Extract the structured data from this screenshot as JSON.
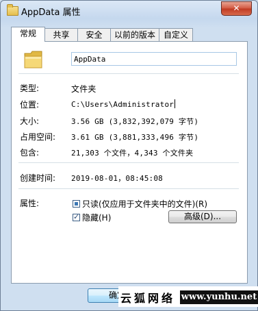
{
  "window": {
    "title": "AppData 属性",
    "close_label": "✕"
  },
  "tabs": [
    {
      "label": "常规",
      "active": true
    },
    {
      "label": "共享",
      "active": false
    },
    {
      "label": "安全",
      "active": false
    },
    {
      "label": "以前的版本",
      "active": false
    },
    {
      "label": "自定义",
      "active": false
    }
  ],
  "general": {
    "folder_name": "AppData",
    "icon": "folder-icon",
    "rows": [
      {
        "label": "类型:",
        "value": "文件夹"
      },
      {
        "label": "位置:",
        "value": "C:\\Users\\Administrator"
      },
      {
        "label": "大小:",
        "value": "3.56 GB (3,832,392,079 字节)"
      },
      {
        "label": "占用空间:",
        "value": "3.61 GB (3,881,333,496 字节)"
      },
      {
        "label": "包含:",
        "value": "21,303 个文件，4,343 个文件夹"
      },
      {
        "label": "创建时间:",
        "value": "2019-08-01，08:45:08"
      }
    ],
    "attributes_label": "属性:",
    "readonly_label": "只读(仅应用于文件夹中的文件)(R)",
    "readonly_state": "indeterminate",
    "hidden_label": "隐藏(H)",
    "hidden_checked": true,
    "advanced_label": "高级(D)..."
  },
  "footer": {
    "ok_label": "确定"
  },
  "watermark": {
    "text_cn": "云狐网络",
    "url": "www.yunhu.net"
  }
}
